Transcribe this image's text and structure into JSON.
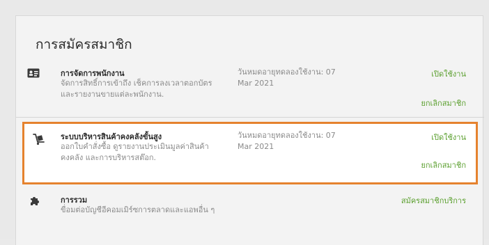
{
  "section": {
    "title": "การสมัครสมาชิก"
  },
  "items": [
    {
      "icon": "id-card-icon",
      "name": "การจัดการพนักงาน",
      "description": "จัดการสิทธิ์การเข้าถึง เช็คการลงเวลาตอกบัตร และรายงานขายแต่ละพนักงาน.",
      "expiry": "วันหมดอายุทดลองใช้งาน: 07 Mar 2021",
      "enable_label": "เปิดใช้งาน",
      "cancel_label": "ยกเลิกสมาชิก"
    },
    {
      "icon": "hand-truck-icon",
      "name": "ระบบบริหารสินค้าคงคลังขั้นสูง",
      "description": "ออกใบคำสั่งซื้อ ดูรายงานประเมินมูลค่าสินค้าคงคลัง และการบริหารสต๊อก.",
      "expiry": "วันหมดอายุทดลองใช้งาน: 07 Mar 2021",
      "enable_label": "เปิดใช้งาน",
      "cancel_label": "ยกเลิกสมาชิก"
    },
    {
      "icon": "puzzle-piece-icon",
      "name": "การรวม",
      "description": "ขื่อมต่อบัญชีอีคอมเมิร์ซการตลาดและแอพอื่น ๆ",
      "subscribe_label": "สมัครสมาชิกบริการ"
    }
  ],
  "colors": {
    "accent_green": "#5ca030",
    "highlight_border": "#e5822e"
  }
}
